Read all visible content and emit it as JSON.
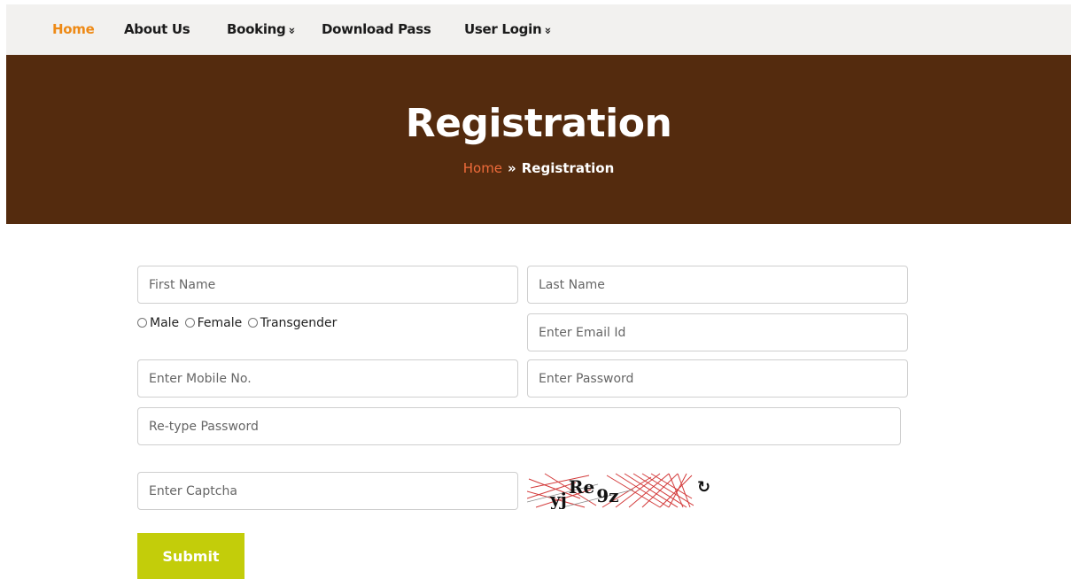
{
  "nav": {
    "home": "Home",
    "about": "About Us",
    "booking": "Booking",
    "download": "Download Pass",
    "login": "User Login",
    "chevron": "»"
  },
  "banner": {
    "title": "Registration",
    "crumb_home": "Home",
    "crumb_sep": "»",
    "crumb_current": "Registration"
  },
  "form": {
    "first_name_placeholder": "First Name",
    "last_name_placeholder": "Last Name",
    "gender_options": [
      "Male",
      "Female",
      "Transgender"
    ],
    "email_placeholder": "Enter Email Id",
    "mobile_placeholder": "Enter Mobile No.",
    "password_placeholder": "Enter Password",
    "retype_placeholder": "Re-type Password",
    "captcha_placeholder": "Enter Captcha",
    "captcha_text": "yjRe9z",
    "refresh_icon": "refresh-icon",
    "submit_label": "Submit"
  },
  "colors": {
    "accent_nav": "#ee8a16",
    "banner_bg": "#542b0e",
    "crumb_home": "#ee6b3a",
    "submit_bg": "#c3cd0a"
  }
}
